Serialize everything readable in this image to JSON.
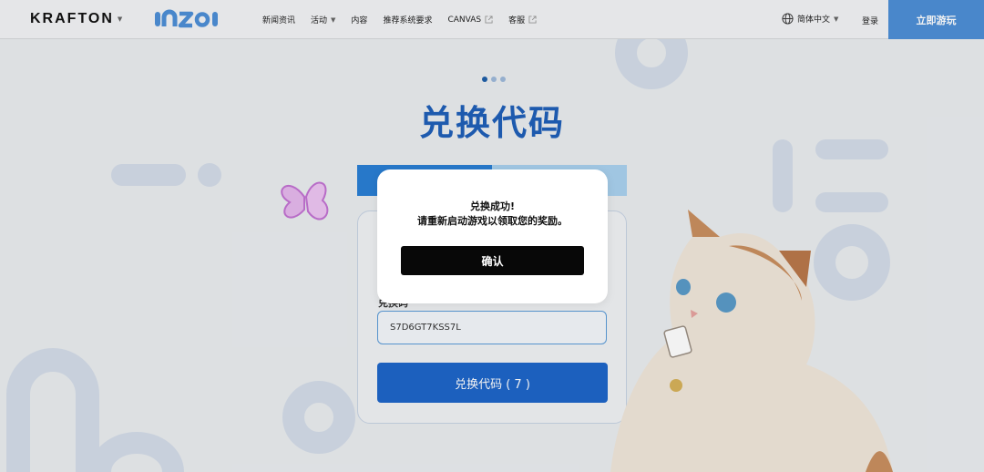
{
  "header": {
    "brand": "KRAFTON",
    "logo": "inZOI",
    "nav": [
      {
        "label": "新闻资讯"
      },
      {
        "label": "活动"
      },
      {
        "label": "内容"
      },
      {
        "label": "推荐系统要求"
      },
      {
        "label": "CANVAS"
      },
      {
        "label": "客服"
      }
    ],
    "language": "简体中文",
    "login": "登录",
    "play": "立即游玩"
  },
  "page": {
    "title": "兑换代码",
    "field_label": "兑换码",
    "code_value": "S7D6GT7KSS7L",
    "redeem_button": "兑换代码 ( 7 )"
  },
  "dialog": {
    "title": "兑换成功!",
    "message": "请重新启动游戏以领取您的奖励。",
    "confirm": "确认"
  },
  "colors": {
    "accent": "#1f5fb8",
    "play_button": "#4d8fd6",
    "confirm_button": "#080808"
  }
}
